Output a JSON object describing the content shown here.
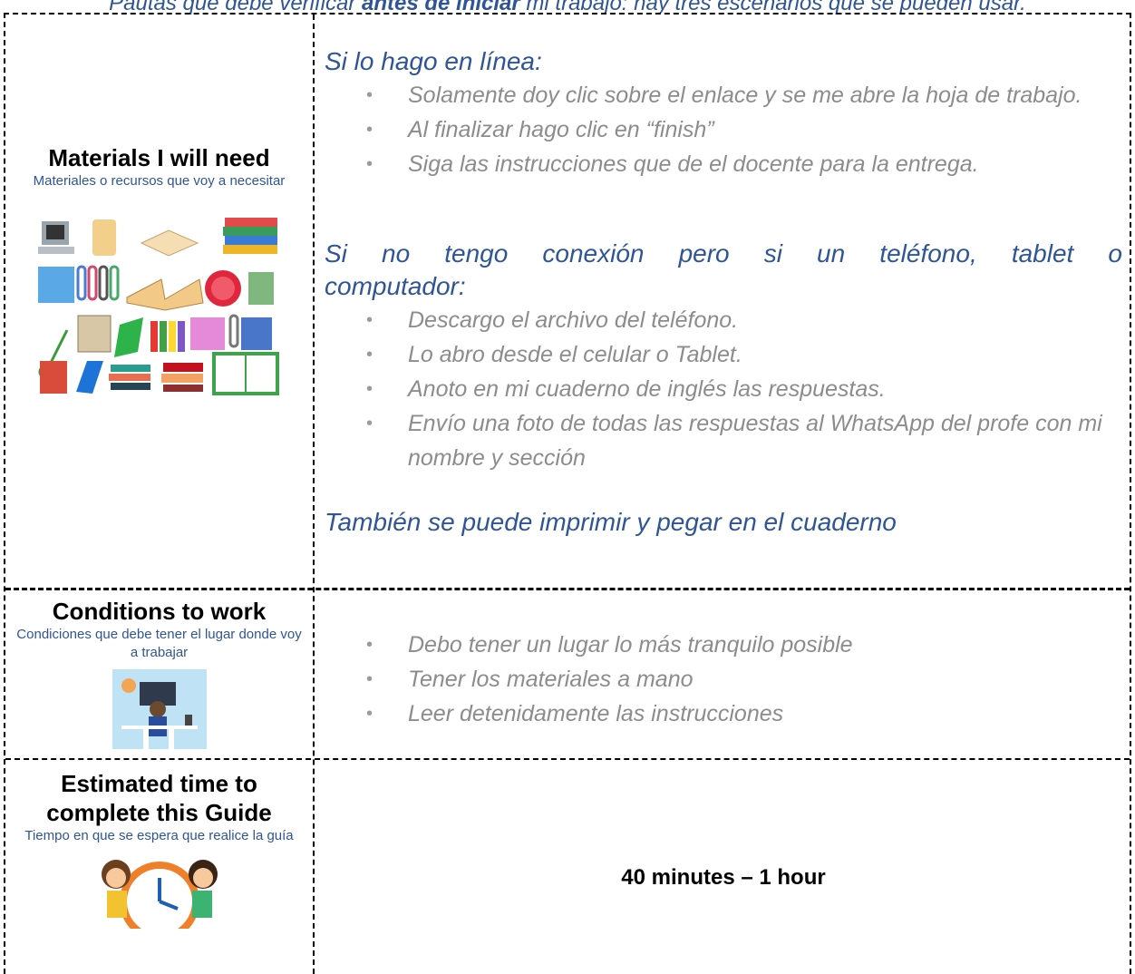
{
  "header": {
    "text_before": "Pautas que debe verificar ",
    "text_bold": "antes de iniciar",
    "text_after": " mi trabajo: hay tres escenarios que se pueden usar."
  },
  "materials": {
    "title": "Materials I will need",
    "subtitle": "Materiales o recursos que voy a necesitar",
    "image_icon": "school-supplies-illustration",
    "online_heading": "Si lo hago en línea:",
    "online_items": [
      "Solamente doy clic sobre el enlace y se me abre la hoja de trabajo.",
      "Al finalizar hago clic en “finish”",
      "Siga las instrucciones que de el docente para la entrega."
    ],
    "offline_heading_line1": "Si no tengo conexión pero si un teléfono, tablet o",
    "offline_heading_line2": "computador:",
    "offline_items": [
      "Descargo el archivo del teléfono.",
      "Lo abro desde el celular o Tablet.",
      "Anoto en mi cuaderno de inglés las respuestas.",
      "Envío una foto de todas las respuestas al WhatsApp del profe con mi nombre y sección"
    ],
    "print_note": "También se puede imprimir y pegar en el cuaderno"
  },
  "conditions": {
    "title": "Conditions to work",
    "subtitle": "Condiciones que debe tener el lugar donde voy a trabajar",
    "image_icon": "person-at-desk-illustration",
    "items": [
      "Debo tener un lugar lo más tranquilo posible",
      "Tener los materiales a mano",
      "Leer detenidamente las instrucciones"
    ]
  },
  "time": {
    "title_line1": "Estimated time to",
    "title_line2": "complete this Guide",
    "subtitle": "Tiempo en que se espera que realice la guía",
    "image_icon": "kids-with-clock-illustration",
    "value": "40  minutes – 1 hour"
  },
  "colors": {
    "accent_blue": "#2f5597",
    "gray_text": "#8c8c8c"
  }
}
